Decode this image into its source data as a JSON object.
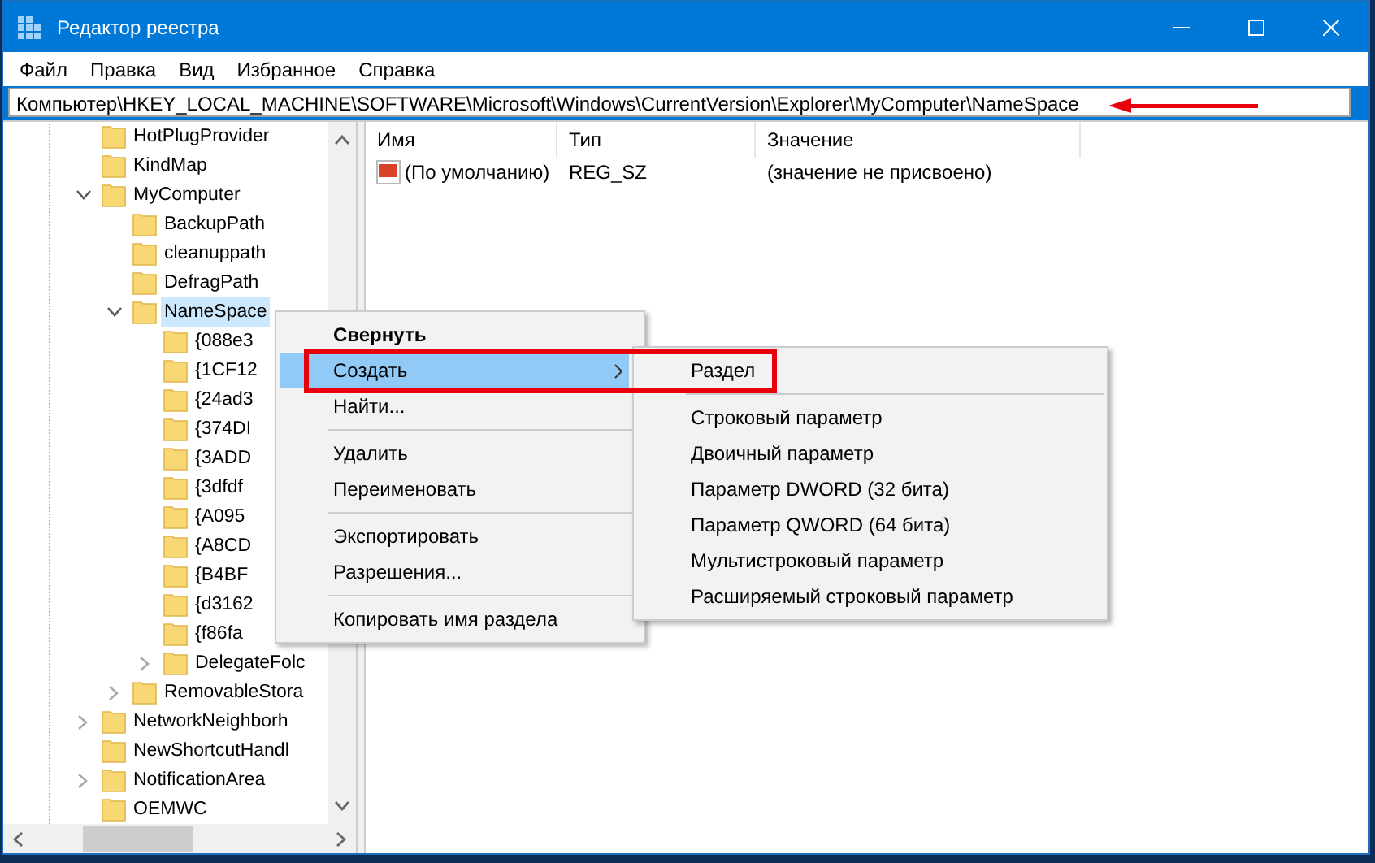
{
  "window": {
    "title": "Редактор реестра"
  },
  "menu_bar": [
    "Файл",
    "Правка",
    "Вид",
    "Избранное",
    "Справка"
  ],
  "address_bar": {
    "value": "Компьютер\\HKEY_LOCAL_MACHINE\\SOFTWARE\\Microsoft\\Windows\\CurrentVersion\\Explorer\\MyComputer\\NameSpace"
  },
  "tree": [
    {
      "label": "HotPlugProvider",
      "selected": false
    },
    {
      "label": "KindMap",
      "selected": false
    },
    {
      "label": "MyComputer",
      "selected": false,
      "expanded": true,
      "children": [
        {
          "label": "BackupPath",
          "selected": false
        },
        {
          "label": "cleanuppath",
          "selected": false
        },
        {
          "label": "DefragPath",
          "selected": false
        },
        {
          "label": "NameSpace",
          "selected": true,
          "expanded": true,
          "children": [
            {
              "label": "{088e3",
              "selected": false
            },
            {
              "label": "{1CF12",
              "selected": false
            },
            {
              "label": "{24ad3",
              "selected": false
            },
            {
              "label": "{374DI",
              "selected": false
            },
            {
              "label": "{3ADD",
              "selected": false
            },
            {
              "label": "{3dfdf",
              "selected": false
            },
            {
              "label": "{A095",
              "selected": false
            },
            {
              "label": "{A8CD",
              "selected": false
            },
            {
              "label": "{B4BF",
              "selected": false
            },
            {
              "label": "{d3162",
              "selected": false
            },
            {
              "label": "{f86fa",
              "selected": false
            },
            {
              "label": "DelegateFolc",
              "selected": false,
              "expanded": false
            }
          ]
        },
        {
          "label": "RemovableStora",
          "selected": false,
          "expanded": false
        }
      ]
    },
    {
      "label": "NetworkNeighborh",
      "selected": false,
      "expanded": false
    },
    {
      "label": "NewShortcutHandl",
      "selected": false
    },
    {
      "label": "NotificationArea",
      "selected": false,
      "expanded": false
    },
    {
      "label": "OEMWC",
      "selected": false
    }
  ],
  "values_table": {
    "columns": [
      "Имя",
      "Тип",
      "Значение"
    ],
    "rows": [
      {
        "name": "(По умолчанию)",
        "type": "REG_SZ",
        "value": "(значение не присвоено)"
      }
    ]
  },
  "context_menu": {
    "items": [
      {
        "kind": "default",
        "label": "Свернуть",
        "selected": false
      },
      {
        "kind": "submenu",
        "label": "Создать",
        "selected": true
      },
      {
        "kind": "item",
        "label": "Найти...",
        "selected": false
      },
      {
        "kind": "separator"
      },
      {
        "kind": "item",
        "label": "Удалить",
        "selected": false
      },
      {
        "kind": "item",
        "label": "Переименовать",
        "selected": false
      },
      {
        "kind": "separator"
      },
      {
        "kind": "item",
        "label": "Экспортировать",
        "selected": false
      },
      {
        "kind": "item",
        "label": "Разрешения...",
        "selected": false
      },
      {
        "kind": "separator"
      },
      {
        "kind": "item",
        "label": "Копировать имя раздела",
        "selected": false
      }
    ]
  },
  "submenu": {
    "items": [
      {
        "kind": "item",
        "label": "Раздел"
      },
      {
        "kind": "separator"
      },
      {
        "kind": "item",
        "label": "Строковый параметр"
      },
      {
        "kind": "item",
        "label": "Двоичный параметр"
      },
      {
        "kind": "item",
        "label": "Параметр DWORD (32 бита)"
      },
      {
        "kind": "item",
        "label": "Параметр QWORD (64 бита)"
      },
      {
        "kind": "item",
        "label": "Мультистроковый параметр"
      },
      {
        "kind": "item",
        "label": "Расширяемый строковый параметр"
      }
    ]
  }
}
